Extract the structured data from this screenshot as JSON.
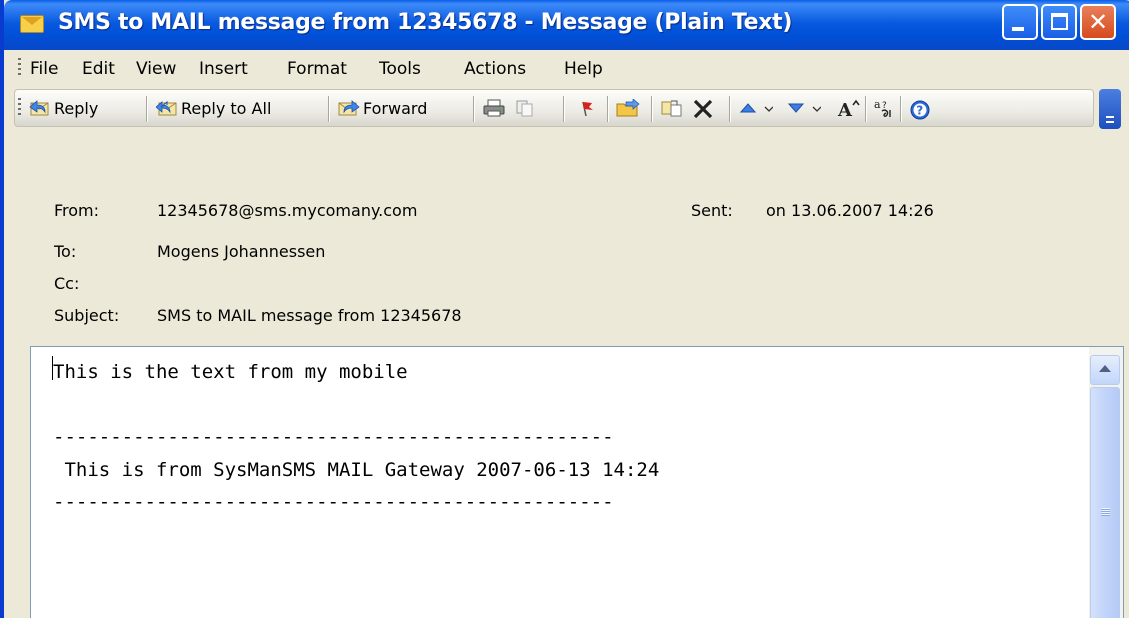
{
  "window": {
    "title": "SMS to MAIL message from 12345678 - Message (Plain Text)",
    "buttons": {
      "minimize": "minimize",
      "maximize": "maximize",
      "close": "✕"
    }
  },
  "menu": [
    "File",
    "Edit",
    "View",
    "Insert",
    "Format",
    "Tools",
    "Actions",
    "Help"
  ],
  "toolbar": {
    "reply": "Reply",
    "reply_all": "Reply to All",
    "forward": "Forward",
    "icons": [
      "print-icon",
      "copy-icon",
      "flag-icon",
      "move-to-folder-icon",
      "create-rule-icon",
      "delete-icon",
      "previous-item-icon",
      "next-item-icon",
      "font-size-icon",
      "encoding-icon",
      "help-icon"
    ]
  },
  "header": {
    "from_label": "From:",
    "from_value": "12345678@sms.mycomany.com",
    "sent_label": "Sent:",
    "sent_value": "on 13.06.2007 14:26",
    "to_label": "To:",
    "to_value": "Mogens Johannessen",
    "cc_label": "Cc:",
    "cc_value": "",
    "subject_label": "Subject:",
    "subject_value": "SMS to MAIL message from 12345678"
  },
  "body": {
    "lines": [
      "This is the text from my mobile",
      "",
      "-------------------------------------------------",
      " This is from SysManSMS MAIL Gateway 2007-06-13 14:24",
      "-------------------------------------------------"
    ]
  },
  "colors": {
    "titlebar": "#0A5AE0",
    "window_face": "#ECE9D8",
    "close_button": "#D64A1E"
  }
}
